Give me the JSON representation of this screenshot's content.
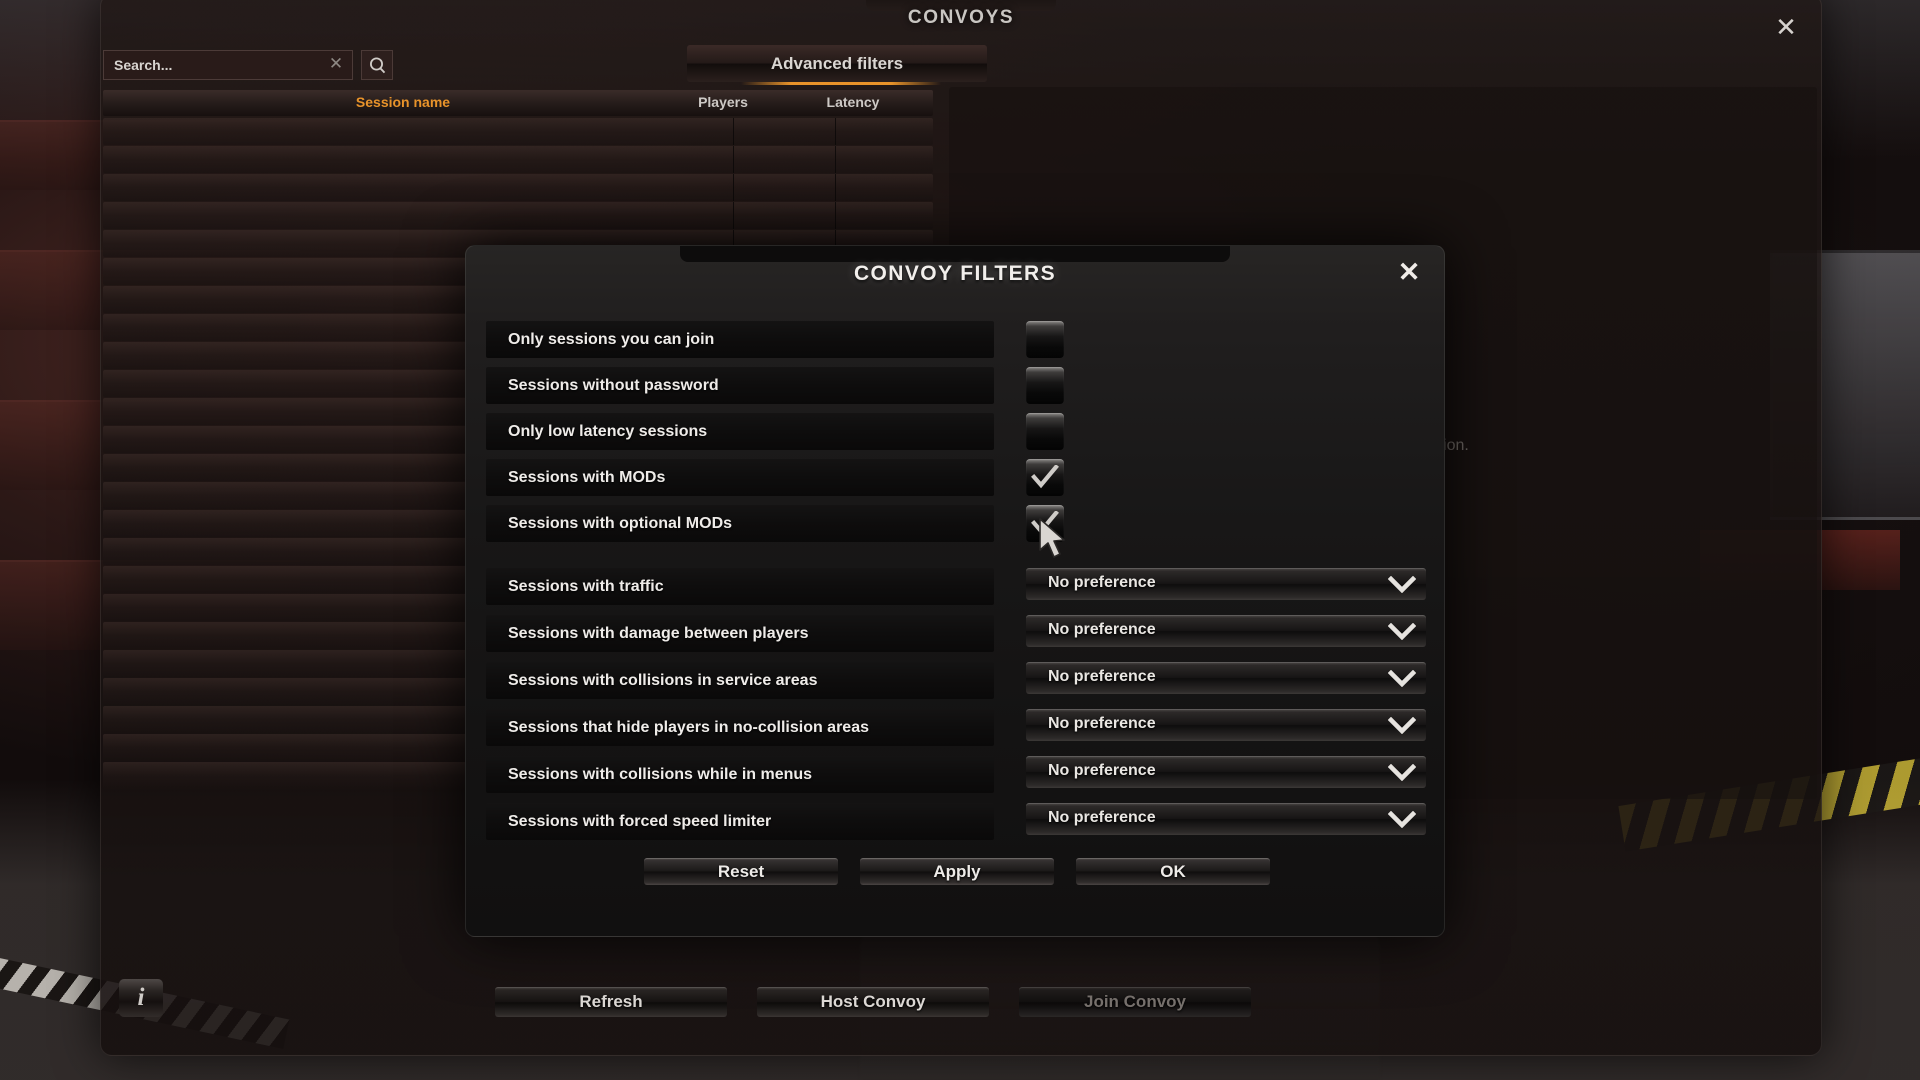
{
  "window": {
    "title": "CONVOYS",
    "close_icon": "✕",
    "search": {
      "placeholder": "Search...",
      "value": "",
      "clear_icon": "✕",
      "search_icon": "search-icon"
    },
    "advanced_filters_label": "Advanced filters",
    "list_headers": {
      "session_name": "Session name",
      "players": "Players",
      "latency": "Latency"
    },
    "detail_empty_text": "Please select a session.",
    "bottom_buttons": {
      "refresh": "Refresh",
      "host_convoy": "Host Convoy",
      "join_convoy": "Join Convoy"
    },
    "info_icon_label": "i",
    "session_row_count": 24
  },
  "modal": {
    "title": "CONVOY FILTERS",
    "close_icon": "✕",
    "checkbox_filters": [
      {
        "label": "Only sessions you can join",
        "checked": false
      },
      {
        "label": "Sessions without password",
        "checked": false
      },
      {
        "label": "Only low latency sessions",
        "checked": false
      },
      {
        "label": "Sessions with MODs",
        "checked": true
      },
      {
        "label": "Sessions with optional MODs",
        "checked": true
      }
    ],
    "dropdown_filters": [
      {
        "label": "Sessions with traffic",
        "value": "No preference"
      },
      {
        "label": "Sessions with damage between players",
        "value": "No preference"
      },
      {
        "label": "Sessions with collisions in service areas",
        "value": "No preference"
      },
      {
        "label": "Sessions that hide players in no-collision areas",
        "value": "No preference"
      },
      {
        "label": "Sessions with collisions while in menus",
        "value": "No preference"
      },
      {
        "label": "Sessions with forced speed limiter",
        "value": "No preference"
      }
    ],
    "buttons": {
      "reset": "Reset",
      "apply": "Apply",
      "ok": "OK"
    }
  },
  "colors": {
    "accent_orange": "#e8932a",
    "text_primary": "#efece9",
    "text_dim": "#6d6763",
    "panel_dark": "#141313"
  }
}
